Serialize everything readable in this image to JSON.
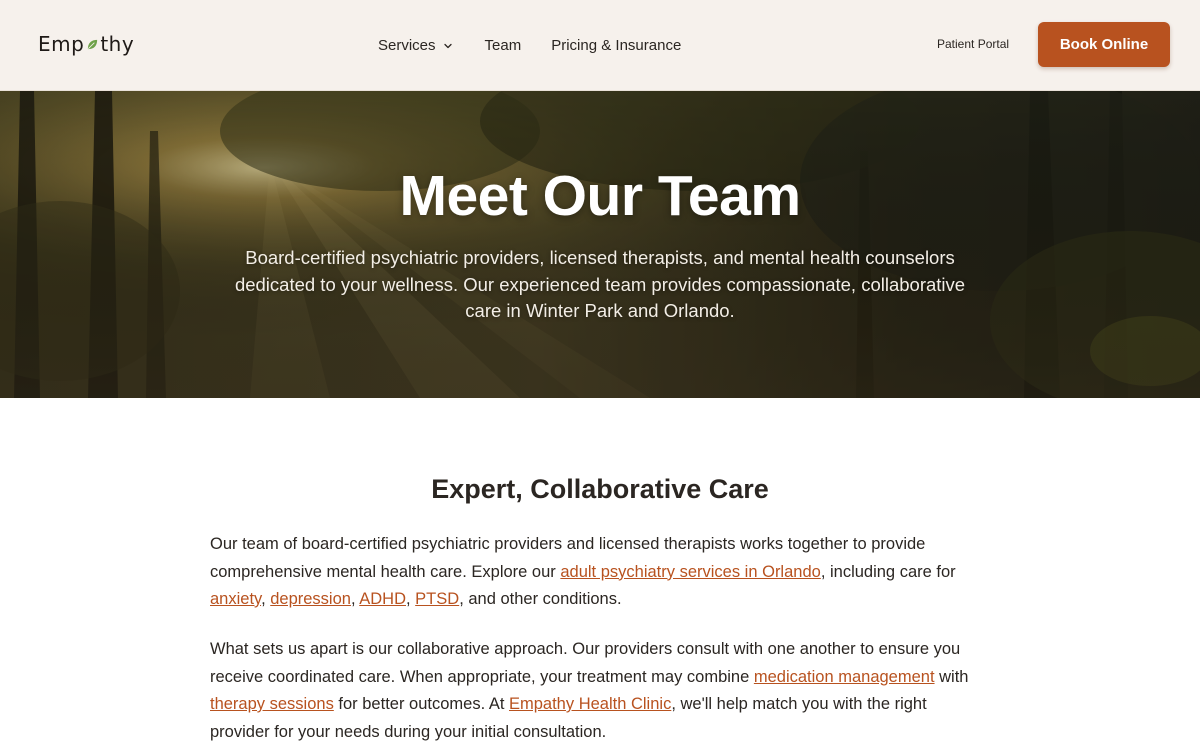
{
  "header": {
    "logo_text_a": "Emp",
    "logo_text_b": "thy",
    "nav": {
      "services": "Services",
      "team": "Team",
      "pricing": "Pricing & Insurance"
    },
    "patient_portal": "Patient Portal",
    "book_online": "Book Online"
  },
  "hero": {
    "title": "Meet Our Team",
    "subtitle": "Board-certified psychiatric providers, licensed therapists, and mental health counselors dedicated to your wellness. Our experienced team provides compassionate, collaborative care in Winter Park and Orlando."
  },
  "content": {
    "heading": "Expert, Collaborative Care",
    "p1": {
      "t1": "Our team of board-certified psychiatric providers and licensed therapists works together to provide comprehensive mental health care. Explore our ",
      "link_psychiatry": "adult psychiatry services in Orlando",
      "t2": ", including care for ",
      "link_anxiety": "anxiety",
      "sep1": ", ",
      "link_depression": "depression",
      "sep2": ", ",
      "link_adhd": "ADHD",
      "sep3": ", ",
      "link_ptsd": "PTSD",
      "t3": ", and other conditions."
    },
    "p2": {
      "t1": "What sets us apart is our collaborative approach. Our providers consult with one another to ensure you receive coordinated care. When appropriate, your treatment may combine ",
      "link_medication": "medication management",
      "t2": " with ",
      "link_therapy": "therapy sessions",
      "t3": " for better outcomes. At ",
      "link_clinic": "Empathy Health Clinic",
      "t4": ", we'll help match you with the right provider for your needs during your initial consultation."
    }
  },
  "icons": {
    "logo_leaf": "leaf-icon",
    "services_dropdown": "chevron-down-icon"
  },
  "colors": {
    "accent": "#b8521f",
    "header_bg": "#f6f1ec",
    "text": "#2b2622",
    "leaf": "#6fa24a"
  }
}
